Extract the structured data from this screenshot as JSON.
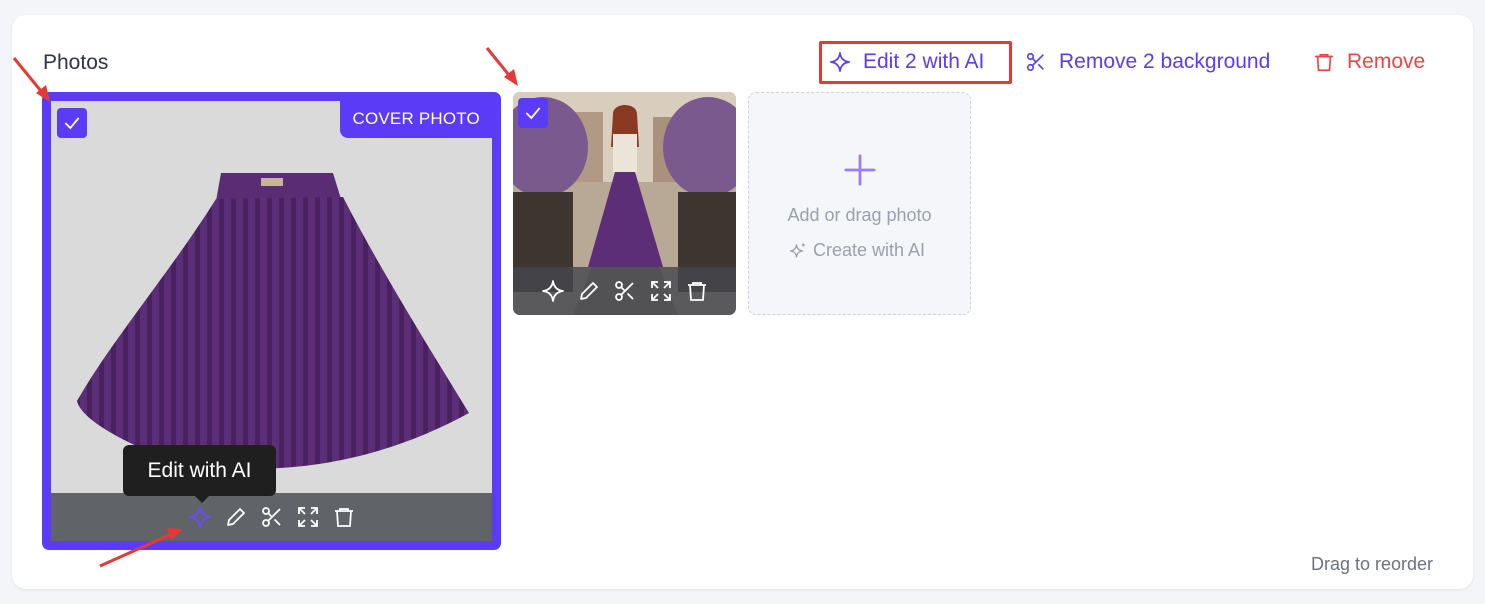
{
  "section": {
    "title": "Photos"
  },
  "toolbar": {
    "edit_ai_label": "Edit 2 with AI",
    "remove_bg_label": "Remove 2 background",
    "remove_label": "Remove"
  },
  "photo1": {
    "cover_badge": "COVER PHOTO",
    "tooltip": "Edit with AI",
    "selected": true
  },
  "photo2": {
    "selected": true
  },
  "add_tile": {
    "add_label": "Add or drag photo",
    "create_ai_label": "Create with AI"
  },
  "footer": {
    "drag_hint": "Drag to reorder"
  },
  "colors": {
    "accent": "#5b3bf5",
    "danger": "#ef4444",
    "annotation": "#e53935"
  }
}
